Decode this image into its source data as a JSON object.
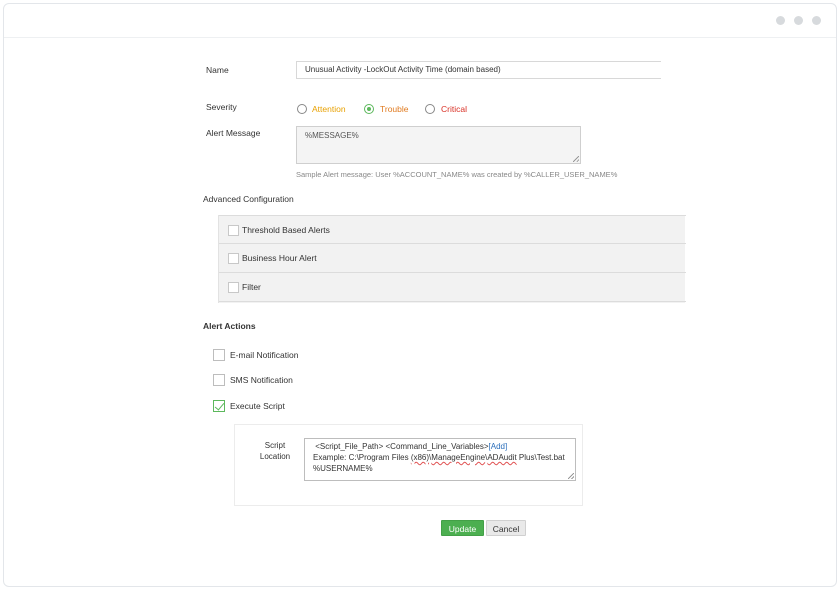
{
  "form": {
    "name_label": "Name",
    "name_value": "Unusual Activity -LockOut Activity Time (domain based)",
    "severity_label": "Severity",
    "severity_options": [
      {
        "label": "Attention",
        "color": "#e8a000",
        "selected": false
      },
      {
        "label": "Trouble",
        "color": "#e07a1f",
        "selected": true
      },
      {
        "label": "Critical",
        "color": "#d93025",
        "selected": false
      }
    ],
    "alert_message_label": "Alert Message",
    "alert_message_value": "%MESSAGE%",
    "alert_message_hint": "Sample Alert message: User %ACCOUNT_NAME% was created by %CALLER_USER_NAME%"
  },
  "advanced": {
    "title": "Advanced Configuration",
    "items": [
      {
        "label": "Threshold Based Alerts",
        "checked": false
      },
      {
        "label": "Business Hour Alert",
        "checked": false
      },
      {
        "label": "Filter",
        "checked": false
      }
    ]
  },
  "actions": {
    "title": "Alert Actions",
    "items": [
      {
        "label": "E-mail Notification",
        "checked": false
      },
      {
        "label": "SMS Notification",
        "checked": false
      },
      {
        "label": "Execute Script",
        "checked": true
      }
    ],
    "script_location_label_1": "Script",
    "script_location_label_2": "Location",
    "script_line1": "<Script_File_Path> <Command_Line_Variables>",
    "script_add": "[Add]",
    "script_line2_a": "Example: C:\\Program Files ",
    "script_line2_b": "(x86)",
    "script_line2_c": "\\",
    "script_line2_d": "ManageEngine",
    "script_line2_e": "\\",
    "script_line2_f": "ADAudit",
    "script_line2_g": " Plus\\Test.bat",
    "script_line3": "%USERNAME%"
  },
  "buttons": {
    "update": "Update",
    "cancel": "Cancel"
  },
  "colors": {
    "accent_green": "#4caf50"
  }
}
